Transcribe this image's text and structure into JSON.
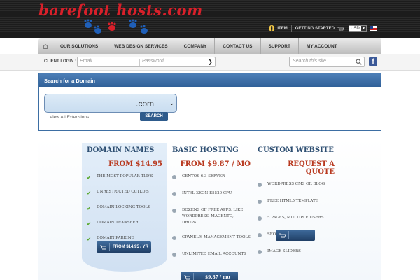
{
  "header": {
    "logo_text": "barefoot hosts.com",
    "cart_count": "0",
    "cart_label": "ITEM",
    "getting_started": "GETTING STARTED",
    "currency": "USD",
    "colors": {
      "logo_red": "#d8202a",
      "feet_blue": "#1f5fb8",
      "feet_red": "#d8202a",
      "cart_yellow": "#f3c847"
    }
  },
  "nav": {
    "items": [
      "OUR SOLUTIONS",
      "WEB DESIGN SERVICES",
      "COMPANY",
      "CONTACT US",
      "SUPPORT",
      "MY ACCOUNT"
    ]
  },
  "login": {
    "label": "CLIENT LOGIN :",
    "email_placeholder": "Email",
    "password_placeholder": "Password",
    "search_placeholder": "Search this site..."
  },
  "domain_search": {
    "title": "Search for a Domain",
    "extension": ".com",
    "view_all": "View All Extensions",
    "button": "SEARCH"
  },
  "products": {
    "domain": {
      "title": "DOMAIN NAMES",
      "price": "FROM $14.95",
      "features": [
        "THE MOST POPULAR TLD'S",
        "UNRESTRICTED CCTLD'S",
        "DOMAIN LOCKING TOOLS",
        "DOMAIN TRANSFER",
        "DOMAIN PARKING"
      ],
      "button": "FROM $14.95 / YR"
    },
    "hosting": {
      "title": "BASIC HOSTING",
      "price": "FROM $9.87 / MO",
      "features": [
        "CENTOS 6.3 SERVER",
        "INTEL XEON E5520 CPU",
        "DOZENS OF FREE APPS, LIKE WORDPRESS, MAGENTO, DRUPAL",
        "CPANEL® MANAGEMENT TOOLS",
        "UNLIMITED EMAIL ACCOUNTS"
      ],
      "button": "$9.87 / mo"
    },
    "custom": {
      "title": "CUSTOM WEBSITE",
      "price": "REQUEST A QUOTE",
      "features": [
        "WORDPRESS CMS OR BLOG",
        "FREE HTML5 TEMPLATE",
        "5 PAGES, MULTIPLE USERS",
        "SEO TOOLS",
        "IMAGE SLIDERS"
      ],
      "button": ""
    }
  }
}
